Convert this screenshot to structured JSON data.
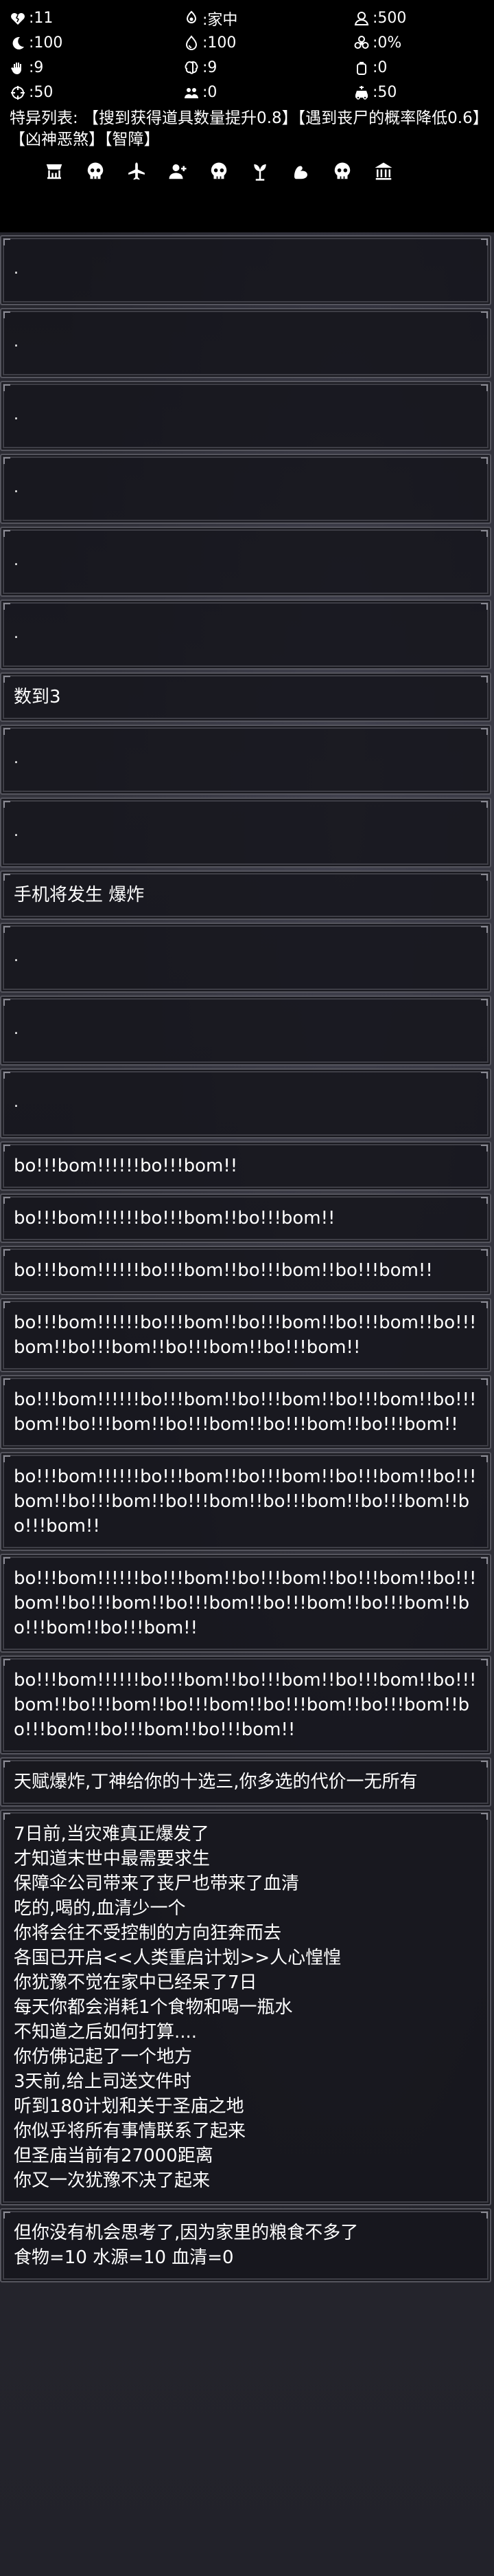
{
  "stats": [
    {
      "icon": "heart-broken-icon",
      "value": ":11"
    },
    {
      "icon": "location-drop-icon",
      "value": ":家中"
    },
    {
      "icon": "money-bag-icon",
      "value": ":500"
    },
    {
      "icon": "moon-icon",
      "value": ":100"
    },
    {
      "icon": "water-drop-icon",
      "value": ":100"
    },
    {
      "icon": "biohazard-icon",
      "value": ":0%"
    },
    {
      "icon": "hand-icon",
      "value": ":9"
    },
    {
      "icon": "brain-icon",
      "value": ":9"
    },
    {
      "icon": "canister-icon",
      "value": ":0"
    },
    {
      "icon": "crosshair-icon",
      "value": ":50"
    },
    {
      "icon": "group-icon",
      "value": ":0"
    },
    {
      "icon": "car-icon",
      "value": ":50"
    }
  ],
  "traits_text": "特异列表: 【搜到获得道具数量提升0.8】【遇到丧尸的概率降低0.6】【凶神恶煞】【智障】",
  "skill_icons": [
    "shop-icon",
    "skull-icon",
    "plane-icon",
    "add-person-icon",
    "skull-icon",
    "plant-icon",
    "muscle-icon",
    "skull-icon",
    "bank-icon"
  ],
  "log": [
    ".",
    ".",
    ".",
    ".",
    ".",
    ".",
    "数到3",
    ".",
    ".",
    "手机将发生 爆炸",
    ".",
    ".",
    ".",
    "bo!!!bom!!!!!!bo!!!bom!!",
    "bo!!!bom!!!!!!bo!!!bom!!bo!!!bom!!",
    "bo!!!bom!!!!!!bo!!!bom!!bo!!!bom!!bo!!!bom!!",
    "bo!!!bom!!!!!!bo!!!bom!!bo!!!bom!!bo!!!bom!!bo!!!bom!!bo!!!bom!!bo!!!bom!!bo!!!bom!!",
    "bo!!!bom!!!!!!bo!!!bom!!bo!!!bom!!bo!!!bom!!bo!!!bom!!bo!!!bom!!bo!!!bom!!bo!!!bom!!bo!!!bom!!",
    "bo!!!bom!!!!!!bo!!!bom!!bo!!!bom!!bo!!!bom!!bo!!!bom!!bo!!!bom!!bo!!!bom!!bo!!!bom!!bo!!!bom!!bo!!!bom!!",
    "bo!!!bom!!!!!!bo!!!bom!!bo!!!bom!!bo!!!bom!!bo!!!bom!!bo!!!bom!!bo!!!bom!!bo!!!bom!!bo!!!bom!!bo!!!bom!!bo!!!bom!!",
    "bo!!!bom!!!!!!bo!!!bom!!bo!!!bom!!bo!!!bom!!bo!!!bom!!bo!!!bom!!bo!!!bom!!bo!!!bom!!bo!!!bom!!bo!!!bom!!bo!!!bom!!bo!!!bom!!",
    "天赋爆炸,丁神给你的十选三,你多选的代价一无所有",
    "7日前,当灾难真正爆发了\n才知道末世中最需要求生\n保障伞公司带来了丧尸也带来了血清\n吃的,喝的,血清少一个\n你将会往不受控制的方向狂奔而去\n各国已开启<<人类重启计划>>人心惶惶\n你犹豫不觉在家中已经呆了7日\n每天你都会消耗1个食物和喝一瓶水\n不知道之后如何打算....\n你仿佛记起了一个地方\n3天前,给上司送文件时\n听到180计划和关于圣庙之地\n你似乎将所有事情联系了起来\n但圣庙当前有27000距离\n你又一次犹豫不决了起来",
    "但你没有机会思考了,因为家里的粮食不多了\n食物=10 水源=10 血清=0"
  ]
}
